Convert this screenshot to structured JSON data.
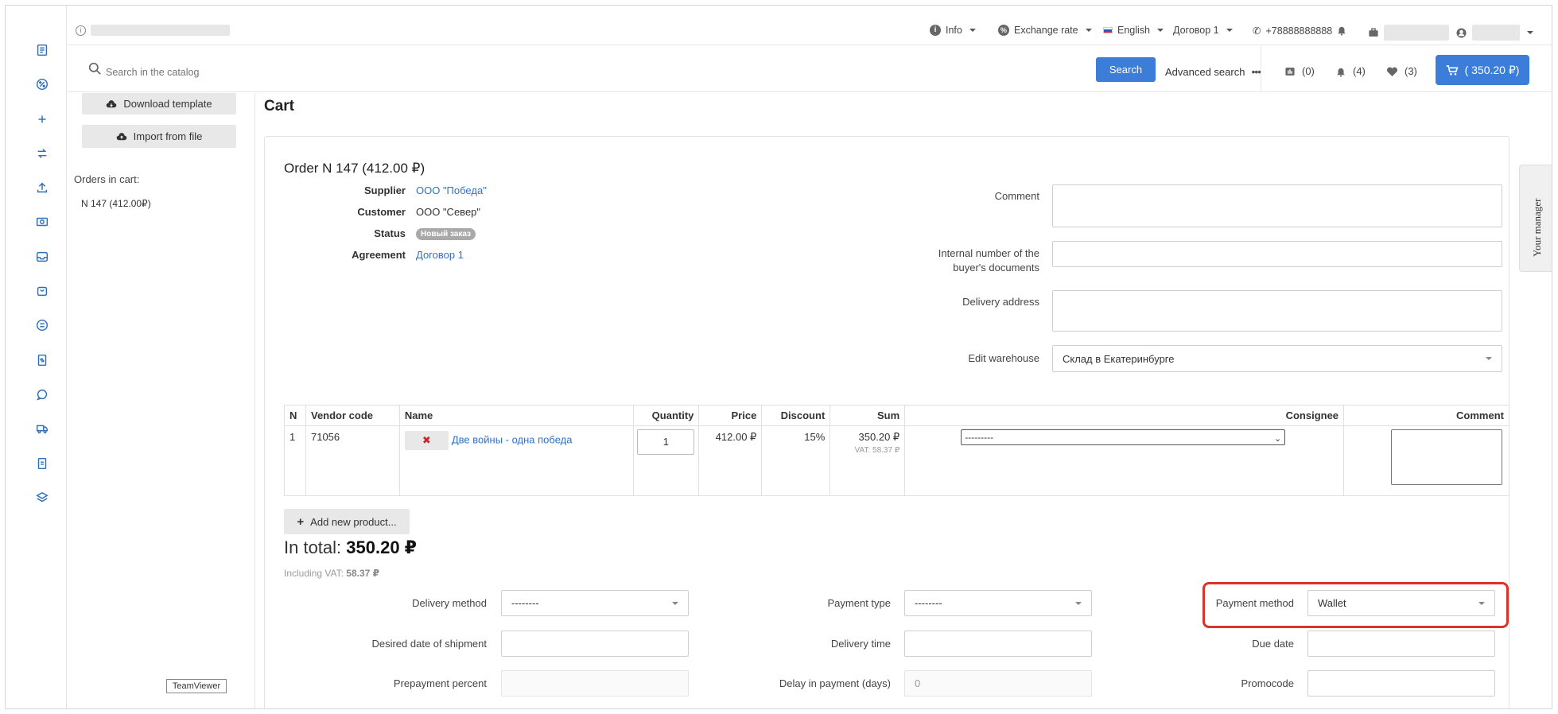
{
  "topbar": {
    "info": "Info",
    "exchange_rate": "Exchange rate",
    "language": "English",
    "agreement": "Договор 1",
    "phone": "+78888888888"
  },
  "search": {
    "placeholder": "Search in the catalog",
    "button": "Search",
    "advanced": "Advanced search",
    "compare_count": "(0)",
    "notifications_count": "(4)",
    "favorites_count": "(3)",
    "cart_total": "( 350.20 ₽)"
  },
  "left_panel": {
    "download_template": "Download template",
    "import_from_file": "Import from file",
    "orders_in_cart": "Orders in cart:",
    "order_item": "N 147 (412.00₽)"
  },
  "page": {
    "title": "Cart"
  },
  "order": {
    "title": "Order N 147 (412.00 ₽)",
    "supplier_label": "Supplier",
    "supplier_value": "ООО \"Победа\"",
    "customer_label": "Customer",
    "customer_value": "ООО \"Север\"",
    "status_label": "Status",
    "status_value": "Новый заказ",
    "agreement_label": "Agreement",
    "agreement_value": "Договор 1"
  },
  "right_form": {
    "comment_label": "Comment",
    "internal_number_label_1": "Internal number of the",
    "internal_number_label_2": "buyer's documents",
    "delivery_address_label": "Delivery address",
    "edit_warehouse_label": "Edit warehouse",
    "warehouse_value": "Склад в Екатеринбурге"
  },
  "table": {
    "headers": [
      "N",
      "Vendor code",
      "Name",
      "Quantity",
      "Price",
      "Discount",
      "Sum",
      "Consignee",
      "Comment"
    ],
    "rows": [
      {
        "n": "1",
        "vendor_code": "71056",
        "name": "Две войны - одна победа",
        "quantity": "1",
        "price": "412.00 ₽",
        "discount": "15%",
        "sum": "350.20 ₽",
        "vat": "VAT: 58.37 ₽",
        "consignee": "---------"
      }
    ]
  },
  "summary": {
    "add_new_product": "Add new product...",
    "in_total_label": "In total:",
    "in_total_value": "350.20 ₽",
    "vat_label": "Including VAT:",
    "vat_value": "58.37 ₽"
  },
  "bottom_form": {
    "delivery_method_label": "Delivery method",
    "delivery_method_value": "--------",
    "payment_type_label": "Payment type",
    "payment_type_value": "--------",
    "payment_method_label": "Payment method",
    "payment_method_value": "Wallet",
    "desired_date_label": "Desired date of shipment",
    "delivery_time_label": "Delivery time",
    "due_date_label": "Due date",
    "prepayment_label": "Prepayment percent",
    "delay_label": "Delay in payment (days)",
    "delay_placeholder": "0",
    "promocode_label": "Promocode"
  },
  "side_tab": {
    "label": "Your manager"
  },
  "teamviewer": {
    "label": "TeamViewer"
  },
  "colors": {
    "accent": "#3c7dd9",
    "link": "#2f73c9",
    "highlight": "#d9342b"
  }
}
